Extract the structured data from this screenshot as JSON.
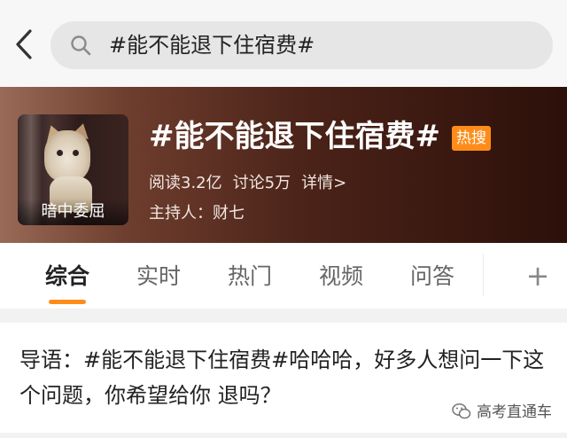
{
  "search": {
    "query": "#能不能退下住宿费#"
  },
  "topic": {
    "cover_caption": "暗中委屈",
    "title": "#能不能退下住宿费#",
    "hot_badge": "热搜",
    "reads": "阅读3.2亿",
    "discussions": "讨论5万",
    "details_link": "详情>",
    "host": "主持人：财七",
    "header_gradient": [
      "#9a6a58",
      "#2c100a"
    ]
  },
  "tabs": {
    "items": [
      {
        "label": "综合",
        "active": true
      },
      {
        "label": "实时",
        "active": false
      },
      {
        "label": "热门",
        "active": false
      },
      {
        "label": "视频",
        "active": false
      },
      {
        "label": "问答",
        "active": false
      }
    ],
    "more_label": "+",
    "accent_color": "#ff8c1a"
  },
  "content": {
    "intro": "导语：#能不能退下住宿费#哈哈哈，好多人想问一下这个问题，你希望给你 退吗？"
  },
  "watermark": {
    "text": "高考直通车",
    "icon": "wechat-icon"
  }
}
